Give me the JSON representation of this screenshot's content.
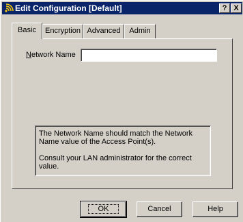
{
  "window": {
    "title": "Edit Configuration [Default]",
    "help_button": "?",
    "close_button": "X"
  },
  "tabs": [
    {
      "label": "Basic",
      "active": true
    },
    {
      "label": "Encryption",
      "active": false
    },
    {
      "label": "Advanced",
      "active": false
    },
    {
      "label": "Admin",
      "active": false
    }
  ],
  "basic": {
    "network_name_label_accel": "N",
    "network_name_label_rest": "etwork Name",
    "network_name_value": ""
  },
  "info": {
    "line1": "The Network Name should match the Network Name value of the Access Point(s).",
    "line2": "Consult your LAN administrator for the correct value."
  },
  "buttons": {
    "ok": "OK",
    "cancel": "Cancel",
    "help": "Help"
  },
  "colors": {
    "titlebar": "#0a246a",
    "face": "#d4d0c8"
  }
}
